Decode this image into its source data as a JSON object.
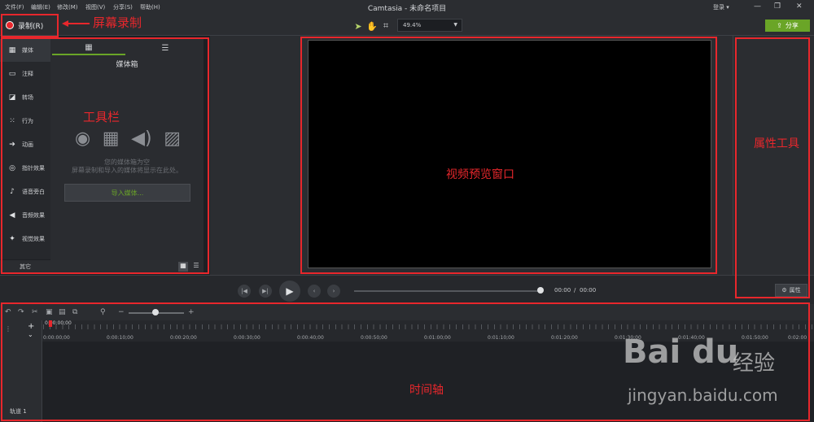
{
  "menu": [
    "文件(F)",
    "编辑(E)",
    "修改(M)",
    "视图(V)",
    "分享(S)",
    "帮助(H)"
  ],
  "app_title": "Camtasia - 未命名项目",
  "login": "登录 ▾",
  "window_controls": [
    "—",
    "❐",
    "✕"
  ],
  "record_label": "录制(R)",
  "zoom_value": "49.4%",
  "share_label": "分享",
  "sidebar": {
    "items": [
      {
        "label": "媒体",
        "icon": "film-icon"
      },
      {
        "label": "注释",
        "icon": "callout-icon"
      },
      {
        "label": "转场",
        "icon": "transition-icon"
      },
      {
        "label": "行为",
        "icon": "behavior-icon"
      },
      {
        "label": "动画",
        "icon": "animation-icon"
      },
      {
        "label": "指针效果",
        "icon": "cursor-effect-icon"
      },
      {
        "label": "语音旁白",
        "icon": "microphone-icon"
      },
      {
        "label": "音频效果",
        "icon": "speaker-icon"
      },
      {
        "label": "视觉效果",
        "icon": "magic-wand-icon"
      }
    ],
    "more_label": "其它",
    "add_label": "+"
  },
  "media_bin": {
    "title": "媒体箱",
    "empty_line1": "您的媒体箱为空",
    "empty_line2": "屏幕录制和导入的媒体将显示在此处。",
    "import_label": "导入媒体..."
  },
  "playback": {
    "current_time": "00:00",
    "separator": "/",
    "total_time": "00:00",
    "properties_label": "属性"
  },
  "timeline": {
    "playhead": "0:00:00;00",
    "ticks": [
      "0:00:00;00",
      "0:00:10;00",
      "0:00:20;00",
      "0:00:30;00",
      "0:00:40;00",
      "0:00:50;00",
      "0:01:00;00",
      "0:01:10;00",
      "0:01:20;00",
      "0:01:30;00",
      "0:01:40;00",
      "0:01:50;00",
      "0:02:00"
    ],
    "track_label": "轨道 1",
    "zoom_minus": "−",
    "zoom_plus": "+"
  },
  "annotations": {
    "screen_record": "屏幕录制",
    "toolbar": "工具栏",
    "preview": "视频预览窗口",
    "properties": "属性工具",
    "timeline": "时间轴"
  },
  "watermark": {
    "logo": "Bai du",
    "cn": "经验",
    "url": "jingyan.baidu.com"
  },
  "colors": {
    "accent": "#6aa527",
    "record": "#e8272c",
    "annotation": "#e8272c"
  }
}
